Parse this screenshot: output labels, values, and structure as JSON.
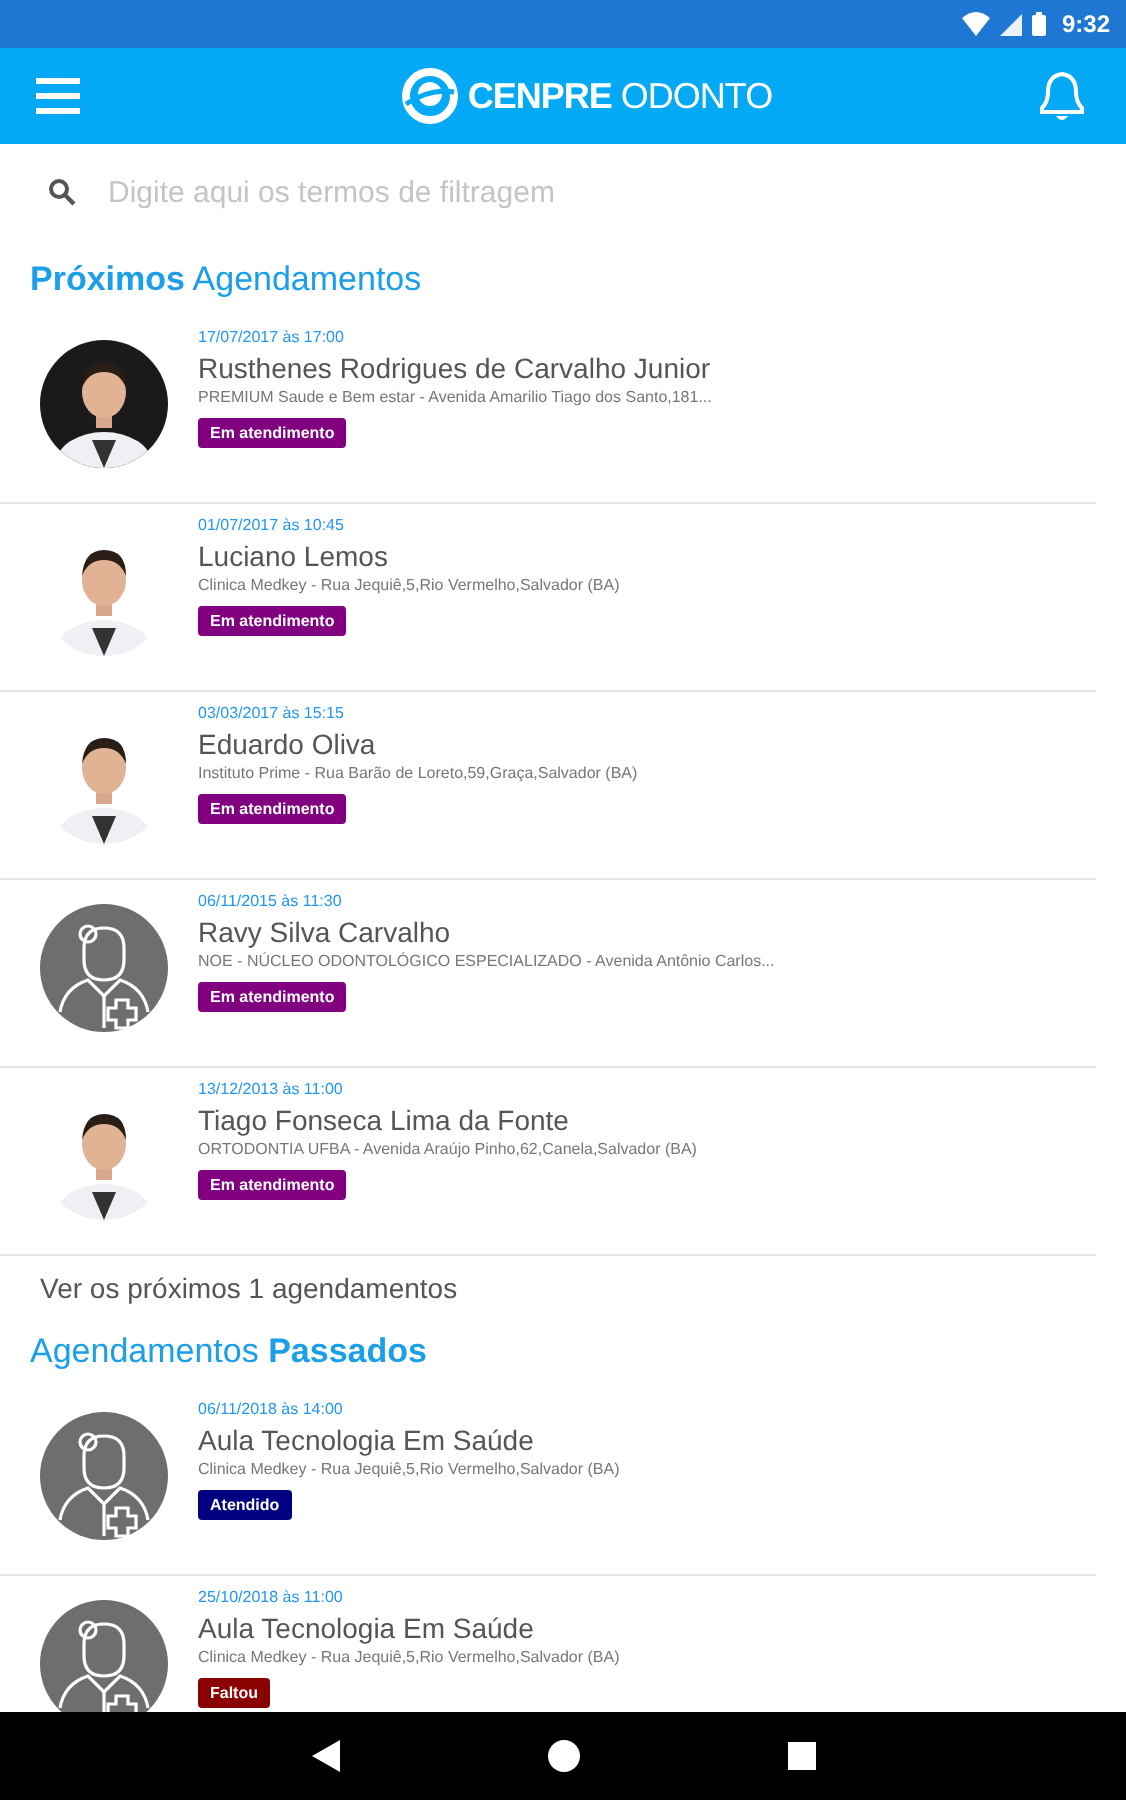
{
  "status_bar": {
    "time": "9:32"
  },
  "app_bar": {
    "logo_bold": "CENPRE",
    "logo_light": "ODONTO"
  },
  "search": {
    "placeholder": "Digite aqui os termos de filtragem"
  },
  "sections": [
    {
      "title": "**Próximos** Agendamentos",
      "items": [
        {
          "date": "17/07/2017 às 17:00",
          "name": "Rusthenes Rodrigues de Carvalho Junior",
          "place": "PREMIUM Saude e Bem estar - Avenida Amarilio Tiago dos Santo,181...",
          "status": "Em atendimento",
          "color": "#800080"
        },
        {
          "date": "01/07/2017 às 10:45",
          "name": "Luciano Lemos",
          "place": "Clinica Medkey - Rua Jequiê,5,Rio Vermelho,Salvador (BA)",
          "status": "Em atendimento",
          "color": "#800080"
        },
        {
          "date": "03/03/2017 às 15:15",
          "name": "Eduardo Oliva",
          "place": "Instituto Prime - Rua Barão de Loreto,59,Graça,Salvador (BA)",
          "status": "Em atendimento",
          "color": "#800080"
        },
        {
          "kind": "placeholder",
          "date": "06/11/2015 às 11:30",
          "name": "Ravy Silva Carvalho",
          "place": "NOE - NÚCLEO ODONTOLÓGICO ESPECIALIZADO - Avenida Antônio Carlos...",
          "status": "Em atendimento",
          "color": "#800080"
        },
        {
          "date": "13/12/2013 às 11:00",
          "name": "Tiago Fonseca Lima da Fonte",
          "place": "ORTODONTIA UFBA - Avenida Araújo Pinho,62,Canela,Salvador (BA)",
          "status": "Em atendimento",
          "color": "#800080"
        }
      ],
      "more": "Ver os próximos 1 agendamentos"
    },
    {
      "title": "Agendamentos **Passados**",
      "items": [
        {
          "kind": "placeholder",
          "date": "06/11/2018 às 14:00",
          "name": "Aula Tecnologia Em Saúde",
          "place": "Clinica Medkey - Rua Jequiê,5,Rio Vermelho,Salvador (BA)",
          "status": "Atendido",
          "color": "#000080"
        },
        {
          "kind": "placeholder",
          "date": "25/10/2018 às 11:00",
          "name": "Aula Tecnologia Em Saúde",
          "place": "Clinica Medkey - Rua Jequiê,5,Rio Vermelho,Salvador (BA)",
          "status": "Faltou",
          "color": "#8b0000"
        }
      ]
    }
  ]
}
